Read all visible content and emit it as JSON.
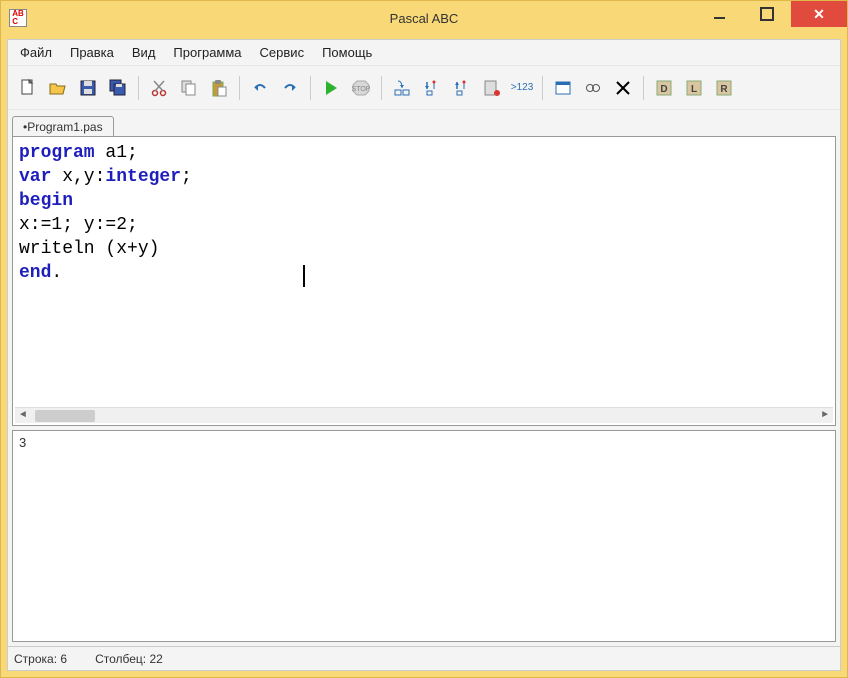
{
  "title": "Pascal ABC",
  "menu": [
    "Файл",
    "Правка",
    "Вид",
    "Программа",
    "Сервис",
    "Помощь"
  ],
  "tab": {
    "name": "•Program1.pas"
  },
  "code": [
    {
      "tokens": [
        {
          "t": "program",
          "c": "kw"
        },
        {
          "t": " a1;",
          "c": ""
        }
      ]
    },
    {
      "tokens": [
        {
          "t": "var",
          "c": "kw"
        },
        {
          "t": " x,y:",
          "c": ""
        },
        {
          "t": "integer",
          "c": "kw"
        },
        {
          "t": ";",
          "c": ""
        }
      ]
    },
    {
      "tokens": [
        {
          "t": "begin",
          "c": "kw"
        }
      ]
    },
    {
      "tokens": [
        {
          "t": "x:=1; y:=2;",
          "c": ""
        }
      ]
    },
    {
      "tokens": [
        {
          "t": "writeln (x+y)",
          "c": ""
        }
      ]
    },
    {
      "tokens": [
        {
          "t": "end",
          "c": "kw"
        },
        {
          "t": ".",
          "c": ""
        }
      ]
    }
  ],
  "output": "3",
  "status": {
    "line_label": "Строка:",
    "line": "6",
    "col_label": "Столбец:",
    "col": "22"
  },
  "over_label": ">123"
}
